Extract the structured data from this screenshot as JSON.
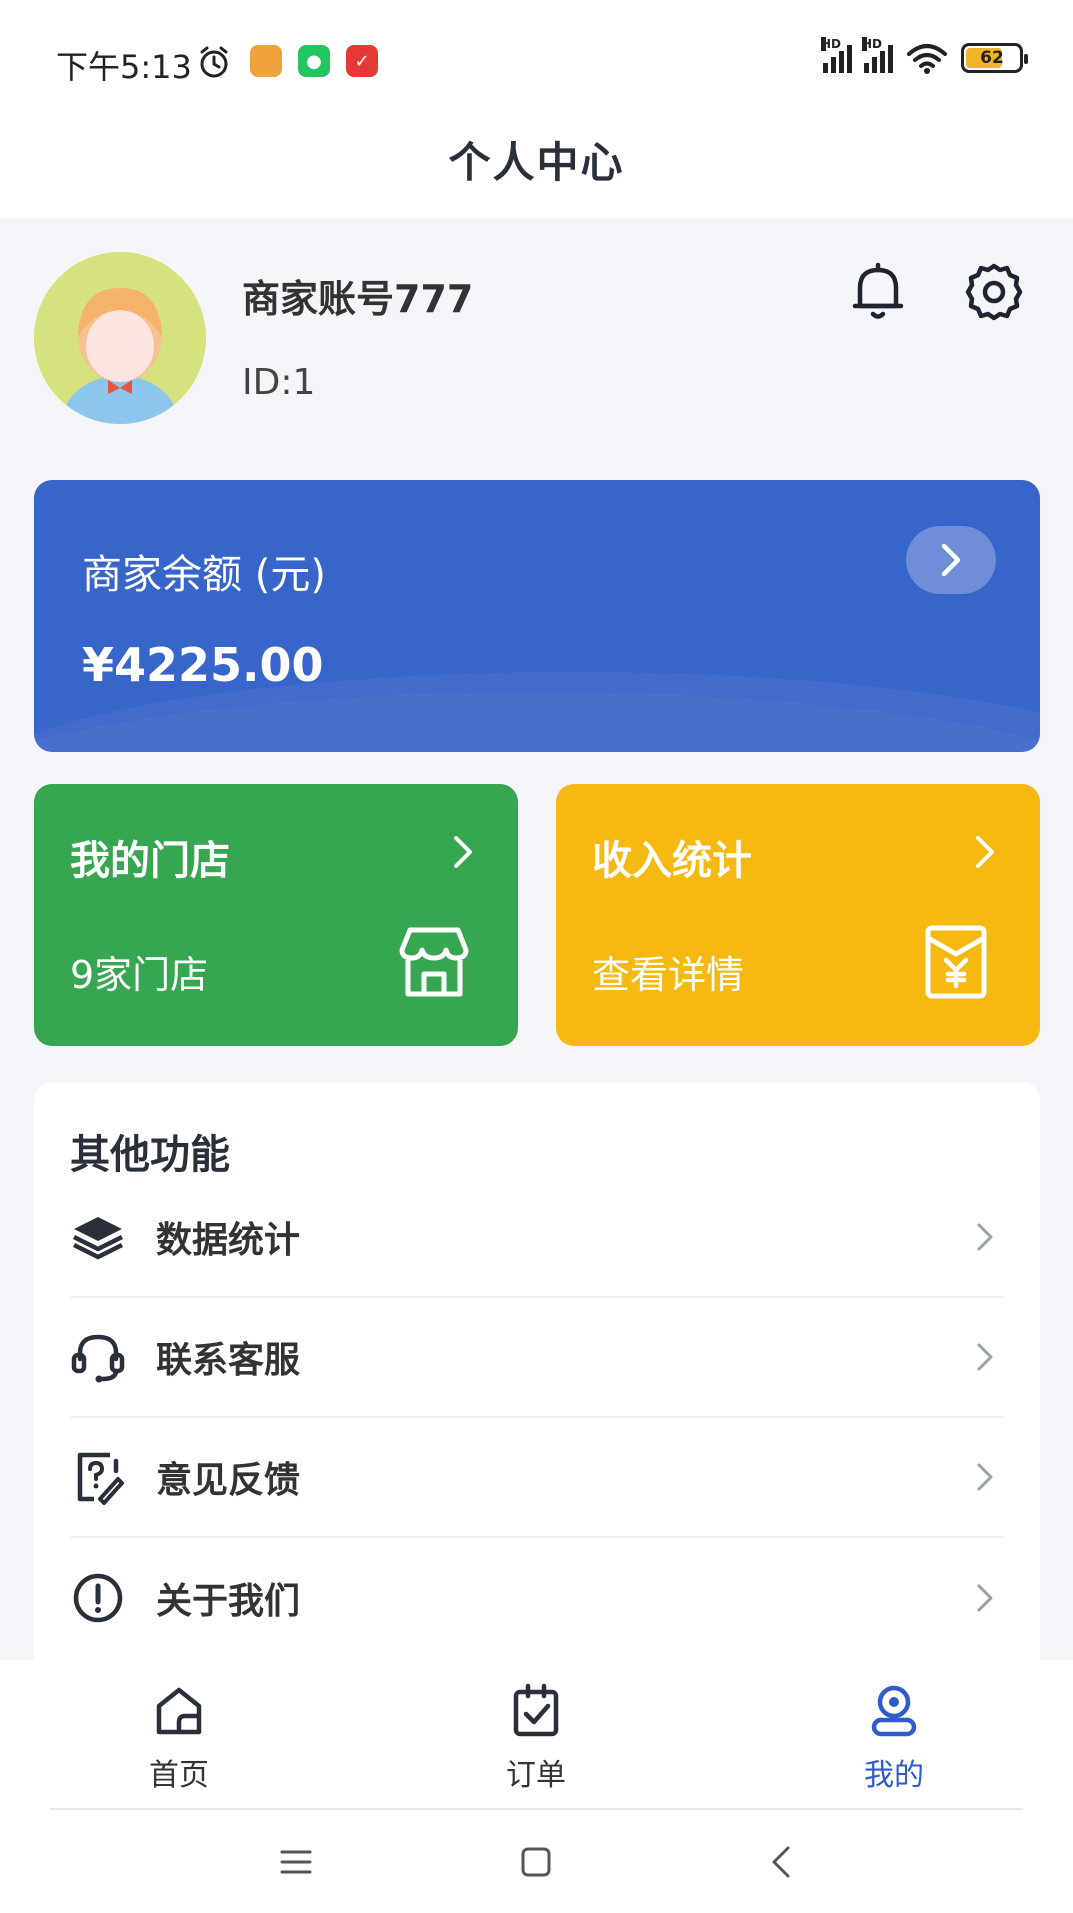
{
  "status_bar": {
    "time": "下午5:13",
    "battery": "62",
    "signal_label": "HD"
  },
  "header": {
    "title": "个人中心"
  },
  "profile": {
    "name": "商家账号777",
    "id": "ID:1"
  },
  "balance": {
    "label": "商家余额 (元)",
    "value": "¥4225.00"
  },
  "tiles": [
    {
      "title": "我的门店",
      "subtitle": "9家门店",
      "color": "#37a650",
      "icon": "store-icon"
    },
    {
      "title": "收入统计",
      "subtitle": "查看详情",
      "color": "#f5b912",
      "icon": "income-envelope-icon"
    }
  ],
  "functions": {
    "title": "其他功能",
    "items": [
      {
        "label": "数据统计",
        "icon": "layers-icon"
      },
      {
        "label": "联系客服",
        "icon": "headset-icon"
      },
      {
        "label": "意见反馈",
        "icon": "feedback-icon"
      },
      {
        "label": "关于我们",
        "icon": "info-icon"
      }
    ]
  },
  "tabbar": {
    "tabs": [
      {
        "label": "首页",
        "icon": "home-icon",
        "active": false
      },
      {
        "label": "订单",
        "icon": "order-clipboard-icon",
        "active": false
      },
      {
        "label": "我的",
        "icon": "profile-icon",
        "active": true
      }
    ],
    "active_color": "#2f5cc7"
  },
  "colors": {
    "balance_card": "#3765c9",
    "background": "#f4f6f9"
  }
}
